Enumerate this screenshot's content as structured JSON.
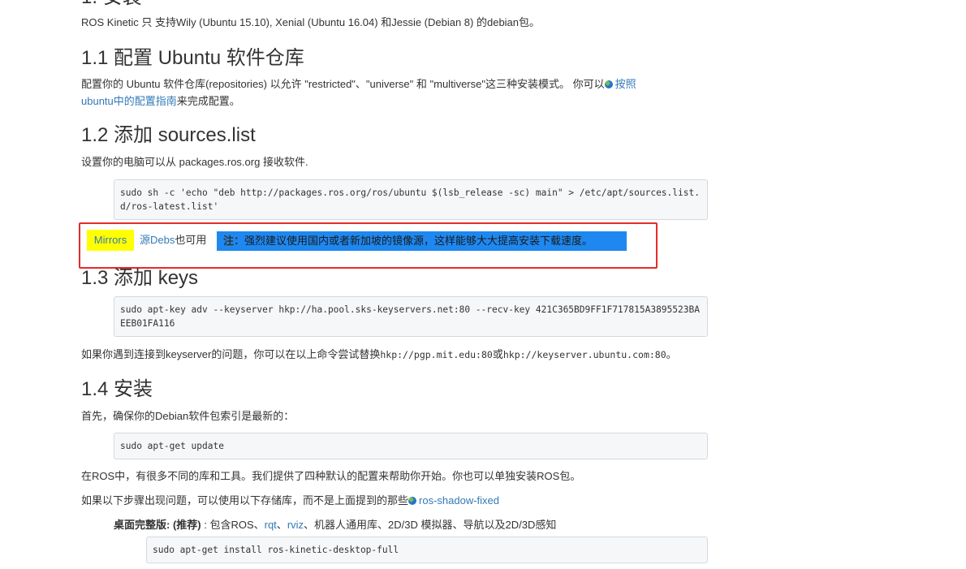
{
  "s1": {
    "heading_partial": "1. 安装",
    "intro": "ROS Kinetic 只 支持Wily (Ubuntu 15.10), Xenial (Ubuntu 16.04) 和Jessie (Debian 8) 的debian包。"
  },
  "s1_1": {
    "heading": "1.1 配置 Ubuntu 软件仓库",
    "text1": "配置你的 Ubuntu 软件仓库(repositories) 以允许 \"restricted\"、\"universe\" 和 \"multiverse\"这三种安装模式。 你可以",
    "link1": "按照",
    "link2": "ubuntu中的配置指南",
    "text2": "来完成配置。"
  },
  "s1_2": {
    "heading": "1.2 添加 sources.list",
    "text": "设置你的电脑可以从 packages.ros.org 接收软件.",
    "code": "sudo sh -c 'echo \"deb http://packages.ros.org/ros/ubuntu $(lsb_release -sc) main\" > /etc/apt/sources.list.d/ros-latest.list'",
    "mirrors": "Mirrors",
    "source_debs_link": "源Debs",
    "also_ok": "也可用",
    "note_label": "注：",
    "note_text": "强烈建议使用国内或者新加坡的镜像源，这样能够大大提高安装下载速度。"
  },
  "s1_3": {
    "heading": "1.3 添加 keys",
    "code": "sudo apt-key adv --keyserver hkp://ha.pool.sks-keyservers.net:80 --recv-key 421C365BD9FF1F717815A3895523BAEEB01FA116",
    "text_before": "如果你遇到连接到keyserver的问题，你可以在以上命令尝试替换",
    "alt1": "hkp://pgp.mit.edu:80",
    "or": "或",
    "alt2": "hkp://keyserver.ubuntu.com:80",
    "end": "。"
  },
  "s1_4": {
    "heading": "1.4 安装",
    "text1": "首先，确保你的Debian软件包索引是最新的：",
    "code1": "sudo apt-get update",
    "text2": "在ROS中，有很多不同的库和工具。我们提供了四种默认的配置来帮助你开始。你也可以单独安装ROS包。",
    "text3": "如果以下步骤出现问题，可以使用以下存储库，而不是上面提到的那些",
    "shadow_link": "ros-shadow-fixed",
    "desktop_full_label": "桌面完整版: (推荐)",
    "desktop_full_text1": " : 包含ROS、",
    "rqt": "rqt",
    "sep": "、",
    "rviz": "rviz",
    "desktop_full_text2": "、机器人通用库、2D/3D 模拟器、导航以及2D/3D感知",
    "code2": "sudo apt-get install ros-kinetic-desktop-full"
  }
}
